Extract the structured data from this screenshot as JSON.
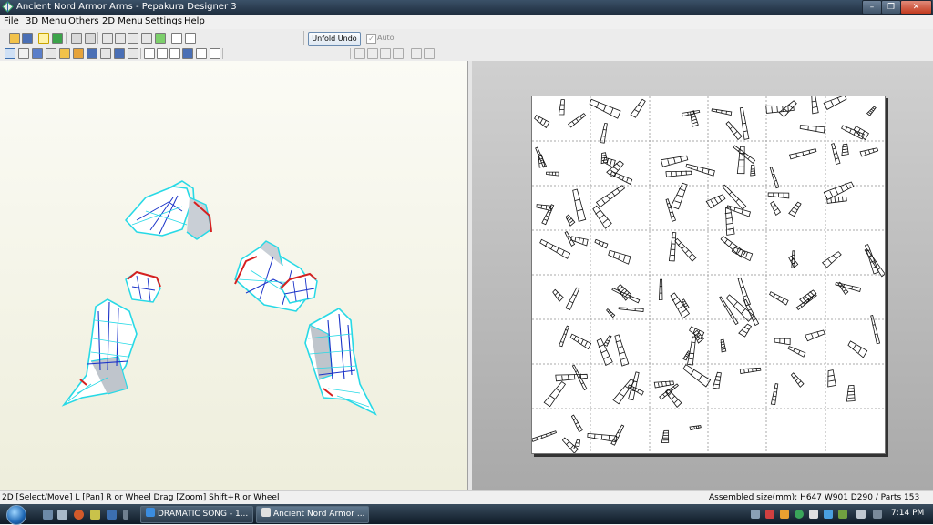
{
  "window": {
    "title": "Ancient Nord Armor Arms - Pepakura Designer 3",
    "controls": {
      "minimize": "–",
      "maximize": "❐",
      "close": "✕"
    }
  },
  "menu": [
    "File",
    "3D Menu",
    "Others",
    "2D Menu",
    "Settings",
    "Help"
  ],
  "toolbar": {
    "unfold_undo_label": "Unfold Undo",
    "auto_label": "Auto",
    "auto_checked": true,
    "top_icons": [
      "open-icon",
      "save-icon",
      "light-icon",
      "texture-icon",
      "rotate-icon",
      "undo-icon",
      "pencil-icon",
      "print-icon",
      "anchor-icon",
      "join-icon",
      "check-icon",
      "view-icon",
      "view-icon"
    ],
    "bottom_icons": [
      "select-icon",
      "pointer-icon",
      "fold-icon",
      "cut-icon",
      "join-edge-icon",
      "flap-icon",
      "face-icon",
      "move-icon",
      "rotate-part-icon",
      "zoom-icon",
      "layout-icon",
      "edit-icon",
      "number-icon",
      "grid-icon",
      "align-icon",
      "align-icon",
      "align-icon",
      "align-icon",
      "undo-icon",
      "redo-icon"
    ]
  },
  "status": {
    "left": "2D [Select/Move] L [Pan] R or Wheel Drag [Zoom] Shift+R or Wheel",
    "right": "Assembled size(mm): H647 W901 D290 / Parts 153"
  },
  "taskbar": {
    "start": "Start",
    "tasks": [
      {
        "label": "DRAMATIC SONG - 1...",
        "icon": "ie-icon",
        "active": false
      },
      {
        "label": "Ancient Nord Armor ...",
        "icon": "pepakura-icon",
        "active": true
      }
    ],
    "clock": "7:14 PM"
  },
  "colors": {
    "model_outline": "#27d9e6",
    "model_fold": "#1a32c8",
    "model_edge": "#d62020",
    "titlebar": "#2b3d52"
  }
}
